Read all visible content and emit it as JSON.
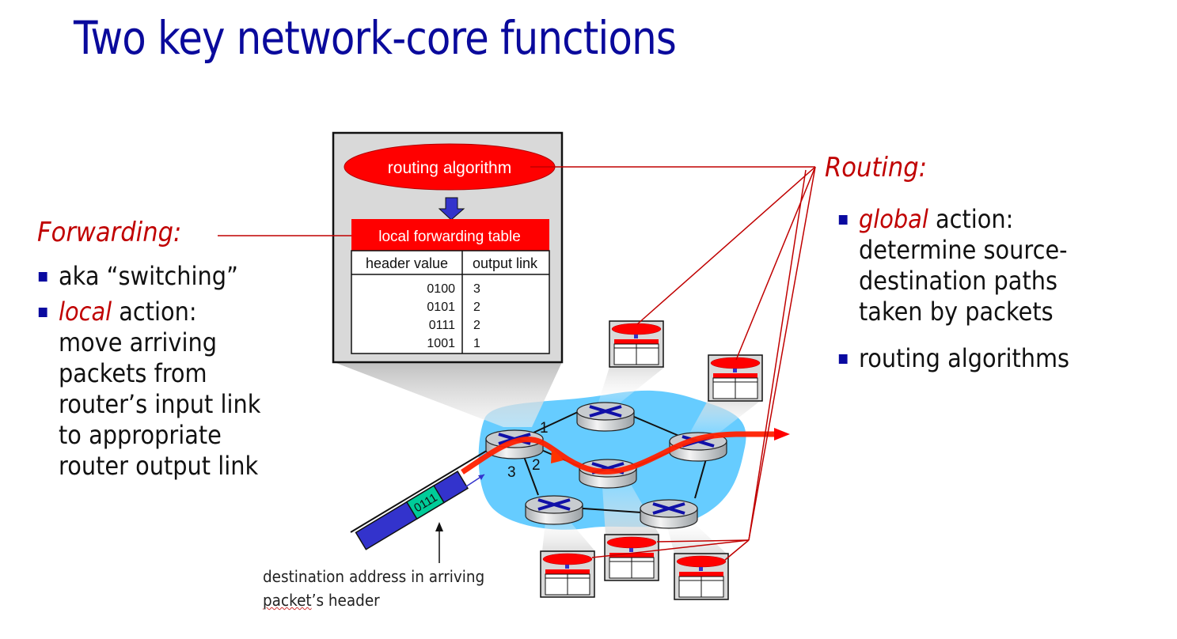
{
  "slide": {
    "title": "Two key network-core functions"
  },
  "forwarding": {
    "heading": "Forwarding:",
    "bullets": [
      {
        "plain": "aka “switching”"
      },
      {
        "em": "local",
        "rest": " action:",
        "lines": [
          "move arriving",
          "packets from",
          "router’s input link",
          "to appropriate",
          "router output link"
        ]
      }
    ]
  },
  "routing": {
    "heading": "Routing:",
    "bullets": [
      {
        "em": "global",
        "rest": " action:",
        "lines": [
          "determine source-",
          "destination paths",
          "taken by packets"
        ]
      },
      {
        "plain": "routing algorithms"
      }
    ]
  },
  "router_detail": {
    "algorithm_label": "routing algorithm",
    "table_title": "local forwarding table",
    "columns": [
      "header value",
      "output link"
    ],
    "rows": [
      {
        "header": "0100",
        "link": "3"
      },
      {
        "header": "0101",
        "link": "2"
      },
      {
        "header": "0111",
        "link": "2"
      },
      {
        "header": "1001",
        "link": "1"
      }
    ]
  },
  "network": {
    "link_labels": [
      "1",
      "2",
      "3"
    ],
    "packet_header": "0111",
    "caption_line1": "destination address in arriving",
    "caption_line2_underlined": "packet",
    "caption_line2_rest": "’s header"
  },
  "colors": {
    "title": "#0a0a9c",
    "accent_red": "#c00000",
    "bright_red": "#ff0000",
    "cloud": "#66ccff",
    "packet_blue": "#3333cc",
    "packet_green": "#00cc99",
    "bullet": "#0a0aa0"
  }
}
